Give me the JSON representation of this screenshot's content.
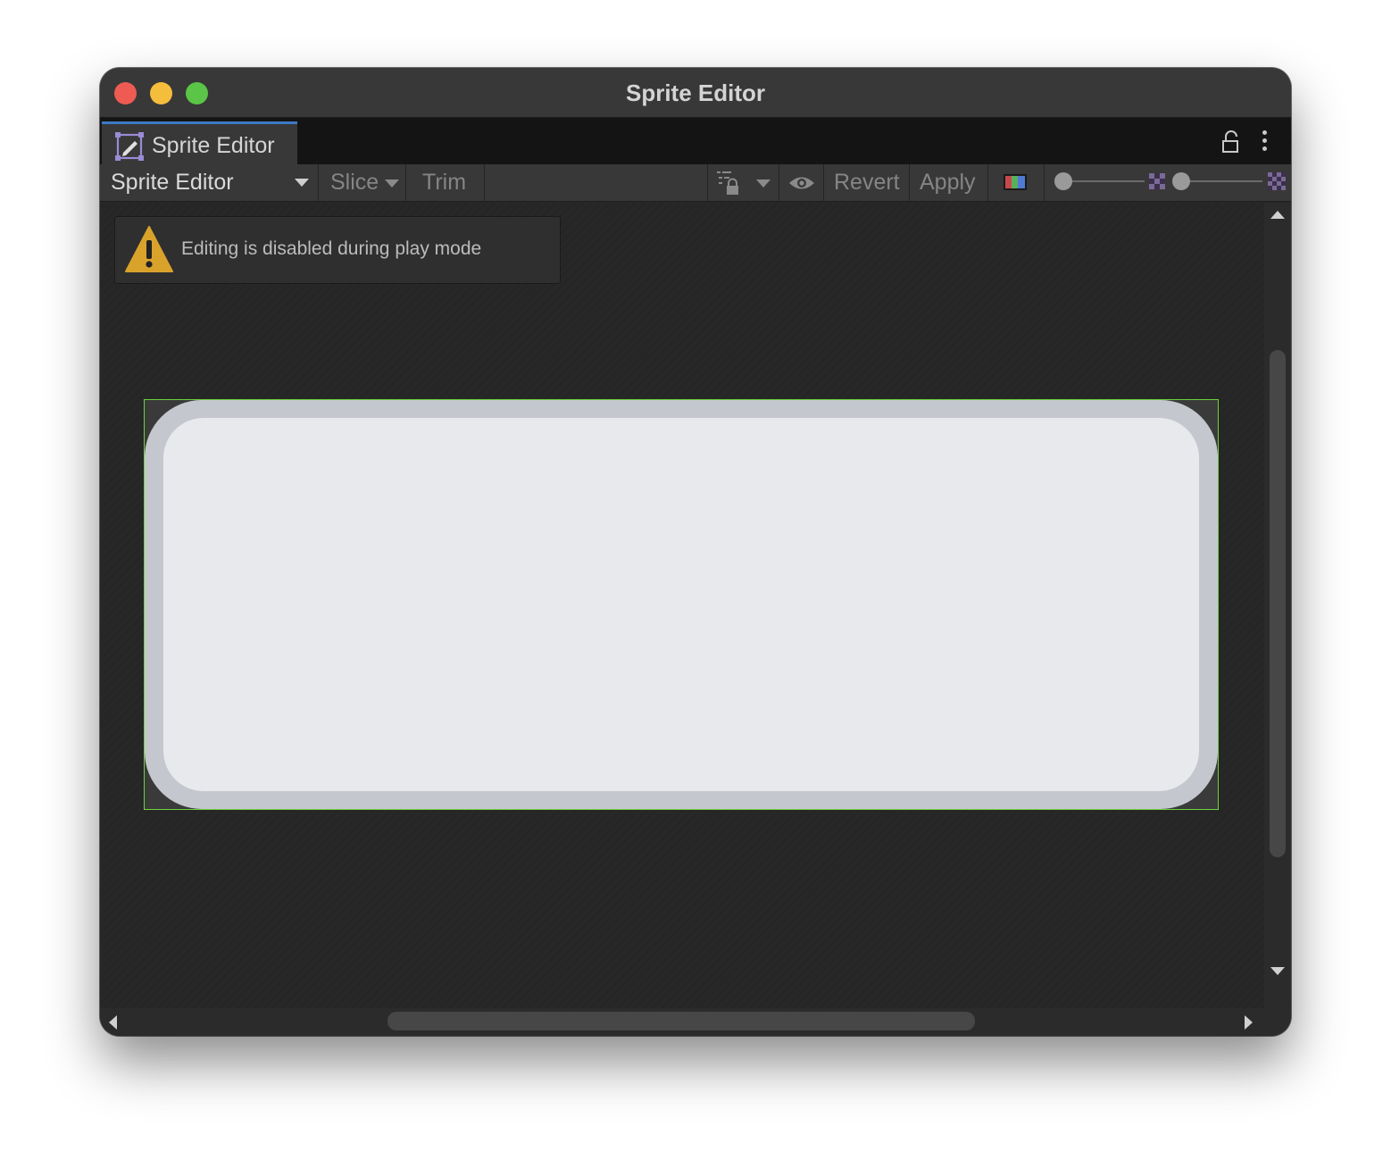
{
  "window": {
    "title": "Sprite Editor",
    "traffic_lights": {
      "close": "#ee5b53",
      "minimize": "#f5bd3c",
      "maximize": "#5ac546"
    }
  },
  "tab": {
    "label": "Sprite Editor",
    "icon": "sprite-editor-icon",
    "accent": "#3e79c4"
  },
  "tab_actions": {
    "lock_icon": "padlock-icon",
    "menu_icon": "kebab-menu-icon"
  },
  "toolbar": {
    "mode_select": "Sprite Editor",
    "slice_label": "Slice",
    "trim_label": "Trim",
    "revert_label": "Revert",
    "apply_label": "Apply",
    "icons": [
      "lock-layers-icon",
      "eye-icon",
      "rgb-channel-icon",
      "checker-small-icon",
      "checker-large-icon"
    ],
    "alpha_slider_value": 0,
    "mipmap_slider_value": 0
  },
  "notice": {
    "text": "Editing is disabled during play mode",
    "icon": "warning-icon",
    "icon_color": "#d9a22b"
  },
  "sprite": {
    "outline_color": "#6cd23c",
    "fill_color": "#e8e9ec",
    "border_color": "#c4c7cd"
  },
  "scrollbars": {
    "vertical_visible": true,
    "horizontal_visible": true
  }
}
